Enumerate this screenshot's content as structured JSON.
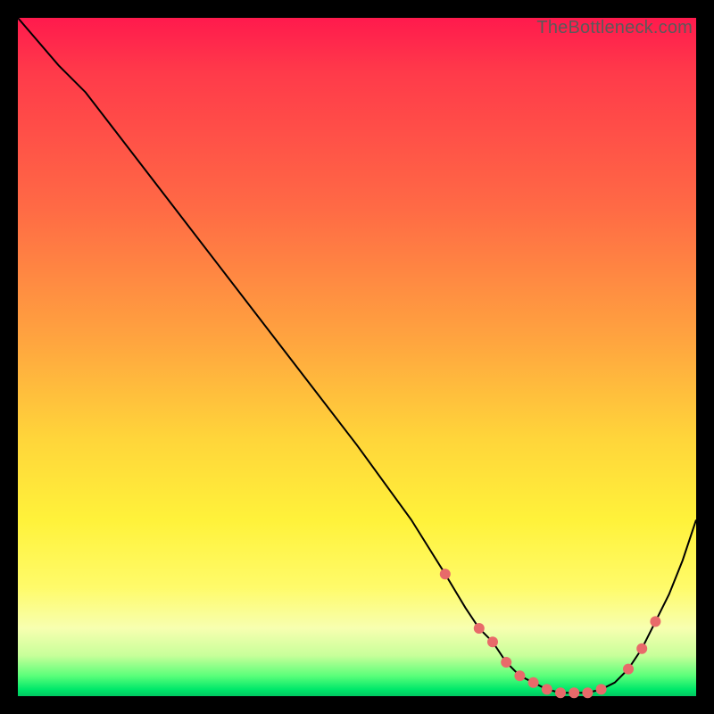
{
  "watermark": "TheBottleneck.com",
  "colors": {
    "curve_stroke": "#000000",
    "marker_fill": "#e86a6a",
    "marker_stroke": "#d85a5a",
    "bg_black": "#000000"
  },
  "chart_data": {
    "type": "line",
    "title": "",
    "xlabel": "",
    "ylabel": "",
    "xlim": [
      0,
      100
    ],
    "ylim": [
      0,
      100
    ],
    "grid": false,
    "legend": false,
    "note": "Gradient background (red→green). Thin black curve dips from top-left to a minimum near x≈78 then rises. Coral dot markers cluster near the minimum.",
    "x": [
      0,
      6,
      10,
      20,
      30,
      40,
      50,
      58,
      63,
      66,
      68,
      70,
      72,
      74,
      76,
      78,
      80,
      82,
      84,
      86,
      88,
      90,
      92,
      94,
      96,
      98,
      100
    ],
    "y": [
      100,
      93,
      89,
      76,
      63,
      50,
      37,
      26,
      18,
      13,
      10,
      8,
      5,
      3,
      2,
      1,
      0.5,
      0.5,
      0.5,
      1,
      2,
      4,
      7,
      11,
      15,
      20,
      26
    ],
    "markers_x": [
      63,
      68,
      70,
      72,
      74,
      76,
      78,
      80,
      82,
      84,
      86,
      90,
      92,
      94
    ],
    "markers_y": [
      18,
      10,
      8,
      5,
      3,
      2,
      1,
      0.5,
      0.5,
      0.5,
      1,
      4,
      7,
      11
    ]
  }
}
